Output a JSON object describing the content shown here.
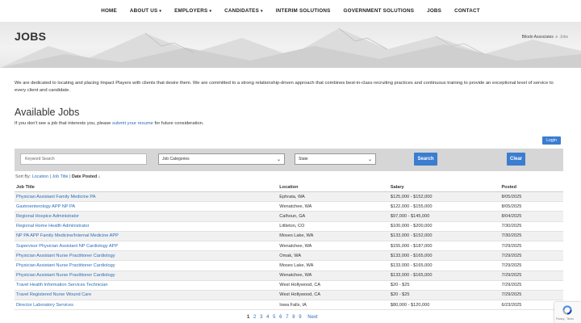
{
  "nav": {
    "items": [
      {
        "label": "HOME",
        "dropdown": false
      },
      {
        "label": "ABOUT US",
        "dropdown": true
      },
      {
        "label": "EMPLOYERS",
        "dropdown": true
      },
      {
        "label": "CANDIDATES",
        "dropdown": true
      },
      {
        "label": "INTERIM SOLUTIONS",
        "dropdown": false
      },
      {
        "label": "GOVERNMENT SOLUTIONS",
        "dropdown": false
      },
      {
        "label": "JOBS",
        "dropdown": false
      },
      {
        "label": "CONTACT",
        "dropdown": false
      }
    ]
  },
  "banner": {
    "title": "JOBS",
    "breadcrumb": {
      "home": "Bilodo Associates",
      "separator": "»",
      "current": "Jobs"
    }
  },
  "intro": "We are dedicated to locating and placing Impact Players with clients that desire them. We are committed to a strong relationship-driven approach that combines best-in-class recruiting practices and continuous training to provide an exceptional level of service to every client and candidate.",
  "available": {
    "heading": "Available Jobs",
    "text_before": "If you don't see a job that interests you, please ",
    "link": "submit your resume",
    "text_after": " for future consideration."
  },
  "login_label": "Login",
  "search": {
    "keyword_placeholder": "Keyword Search",
    "category_value": "Job Categories",
    "state_value": "State",
    "search_label": "Search",
    "clear_label": "Clear"
  },
  "sort": {
    "label": "Sort By:",
    "location": "Location",
    "sep": "|",
    "job_title": "Job Title",
    "date_posted": "Date Posted",
    "arrow": "↓"
  },
  "table": {
    "headers": [
      "Job Title",
      "Location",
      "Salary",
      "Posted"
    ],
    "rows": [
      [
        "Physician Assistant Family Medicine PA",
        "Ephrata, WA",
        "$125,000 - $152,000",
        "8/05/2025"
      ],
      [
        "Gastroenterology APP NP PA",
        "Wenatchee, WA",
        "$122,000 - $155,000",
        "8/05/2025"
      ],
      [
        "Regional Hospice Administrator",
        "Calhoun, GA",
        "$97,000 - $145,000",
        "8/04/2025"
      ],
      [
        "Regional Home Health Administrator",
        "Littleton, CO",
        "$100,000 - $200,000",
        "7/30/2025"
      ],
      [
        "NP PA APP Family Medicine/Internal Medicine APP",
        "Moses Lake, WA",
        "$133,000 - $152,000",
        "7/30/2025"
      ],
      [
        "Supervisor Physician Assistant NP Cardiology APP",
        "Wenatchee, WA",
        "$155,000 - $187,000",
        "7/29/2025"
      ],
      [
        "Physician Assistant Nurse Practitioner Cardiology",
        "Omak, WA",
        "$133,000 - $165,000",
        "7/29/2025"
      ],
      [
        "Physician Assistant Nurse Practitioner Cardiology",
        "Moses Lake, WA",
        "$133,000 - $165,000",
        "7/29/2025"
      ],
      [
        "Physician Assistant Nurse Practitioner Cardiology",
        "Wenatchee, WA",
        "$133,000 - $165,000",
        "7/29/2025"
      ],
      [
        "Travel Health Information Services Technician",
        "West Hollywood, CA",
        "$20 - $25",
        "7/29/2025"
      ],
      [
        "Travel Registered Nurse Wound Care",
        "West Hollywood, CA",
        "$20 - $25",
        "7/29/2025"
      ],
      [
        "Director Laboratory Services",
        "Iowa Falls, IA",
        "$80,000 - $120,000",
        "6/23/2025"
      ]
    ]
  },
  "pagination": {
    "pages": [
      "1",
      "2",
      "3",
      "4",
      "5",
      "6",
      "7",
      "8",
      "9"
    ],
    "current": "1",
    "next": "Next"
  },
  "recaptcha": {
    "privacy": "Privacy",
    "sep": " - ",
    "terms": "Terms"
  },
  "colors": {
    "accent": "#3b7dd1",
    "link": "#2a6db8",
    "search_bar": "#d6d6d6"
  }
}
